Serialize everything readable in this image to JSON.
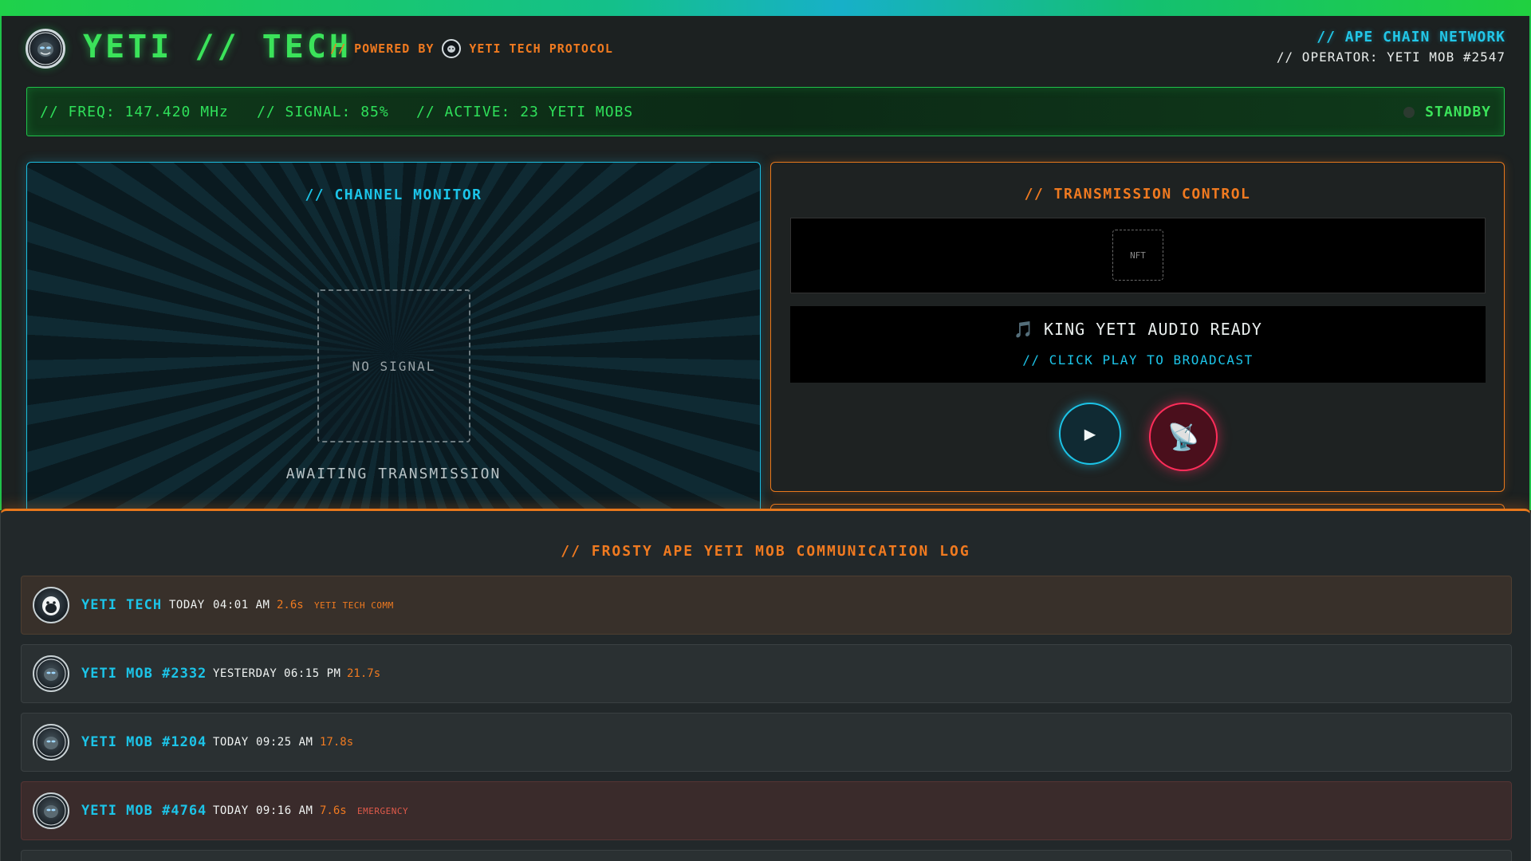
{
  "header": {
    "title": "YETI // TECH",
    "powered_by": "// POWERED BY",
    "protocol": "YETI TECH PROTOCOL",
    "network": "// APE CHAIN NETWORK",
    "operator": "// OPERATOR: YETI MOB #2547"
  },
  "status": {
    "freq": "// FREQ: 147.420 MHz",
    "signal": "// SIGNAL: 85%",
    "active": "// ACTIVE: 23 YETI MOBS",
    "state": "STANDBY"
  },
  "monitor": {
    "title": "// CHANNEL MONITOR",
    "no_signal": "NO SIGNAL",
    "awaiting": "AWAITING TRANSMISSION"
  },
  "control": {
    "title": "// TRANSMISSION CONTROL",
    "nft_placeholder": "NFT",
    "audio_icon": "🎵",
    "audio_title": "KING YETI AUDIO READY",
    "audio_sub": "// CLICK PLAY TO BROADCAST",
    "play_icon": "▶",
    "broadcast_icon": "📡"
  },
  "log": {
    "title": "// FROSTY APE YETI MOB COMMUNICATION LOG",
    "rows": [
      {
        "name": "YETI TECH",
        "day": "TODAY",
        "time": "04:01 AM",
        "duration": "2.6s",
        "tag": "YETI TECH COMM"
      },
      {
        "name": "YETI MOB #2332",
        "day": "YESTERDAY",
        "time": "06:15 PM",
        "duration": "21.7s",
        "tag": ""
      },
      {
        "name": "YETI MOB #1204",
        "day": "TODAY",
        "time": "09:25 AM",
        "duration": "17.8s",
        "tag": ""
      },
      {
        "name": "YETI MOB #4764",
        "day": "TODAY",
        "time": "09:16 AM",
        "duration": "7.6s",
        "tag": "EMERGENCY"
      }
    ]
  },
  "colors": {
    "accent_green": "#3be35a",
    "accent_cyan": "#1cc4e8",
    "accent_orange": "#f07a20",
    "accent_red": "#ff2d5a"
  }
}
